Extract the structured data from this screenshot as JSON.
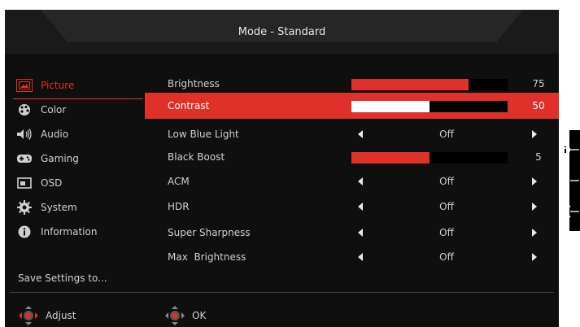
{
  "title": "Mode - Standard",
  "nav": [
    {
      "label": "Picture",
      "icon": "picture-icon",
      "active": true
    },
    {
      "label": "Color",
      "icon": "palette-icon"
    },
    {
      "label": "Audio",
      "icon": "speaker-icon"
    },
    {
      "label": "Gaming",
      "icon": "gamepad-icon"
    },
    {
      "label": "OSD",
      "icon": "osd-icon"
    },
    {
      "label": "System",
      "icon": "gear-icon"
    },
    {
      "label": "Information",
      "icon": "info-icon"
    }
  ],
  "save_label": "Save Settings to...",
  "settings": [
    {
      "label": "Brightness",
      "type": "slider",
      "value": 75
    },
    {
      "label": "Contrast",
      "type": "slider",
      "value": 50,
      "selected": true
    },
    {
      "label": "Low Blue Light",
      "type": "option",
      "value": "Off"
    },
    {
      "label": "Black Boost",
      "type": "slider",
      "value": 5
    },
    {
      "label": "ACM",
      "type": "option",
      "value": "Off"
    },
    {
      "label": "HDR",
      "type": "option",
      "value": "Off"
    },
    {
      "label": "Super Sharpness",
      "type": "option",
      "value": "Off"
    },
    {
      "label": "Max  Brightness",
      "type": "option",
      "value": "Off"
    }
  ],
  "footer": {
    "adjust_label": "Adjust",
    "ok_label": "OK"
  },
  "colors": {
    "accent": "#e0302a",
    "background": "#0f0f0f"
  },
  "side_icons": [
    "info-icon",
    "grid-icon",
    "close-icon"
  ]
}
